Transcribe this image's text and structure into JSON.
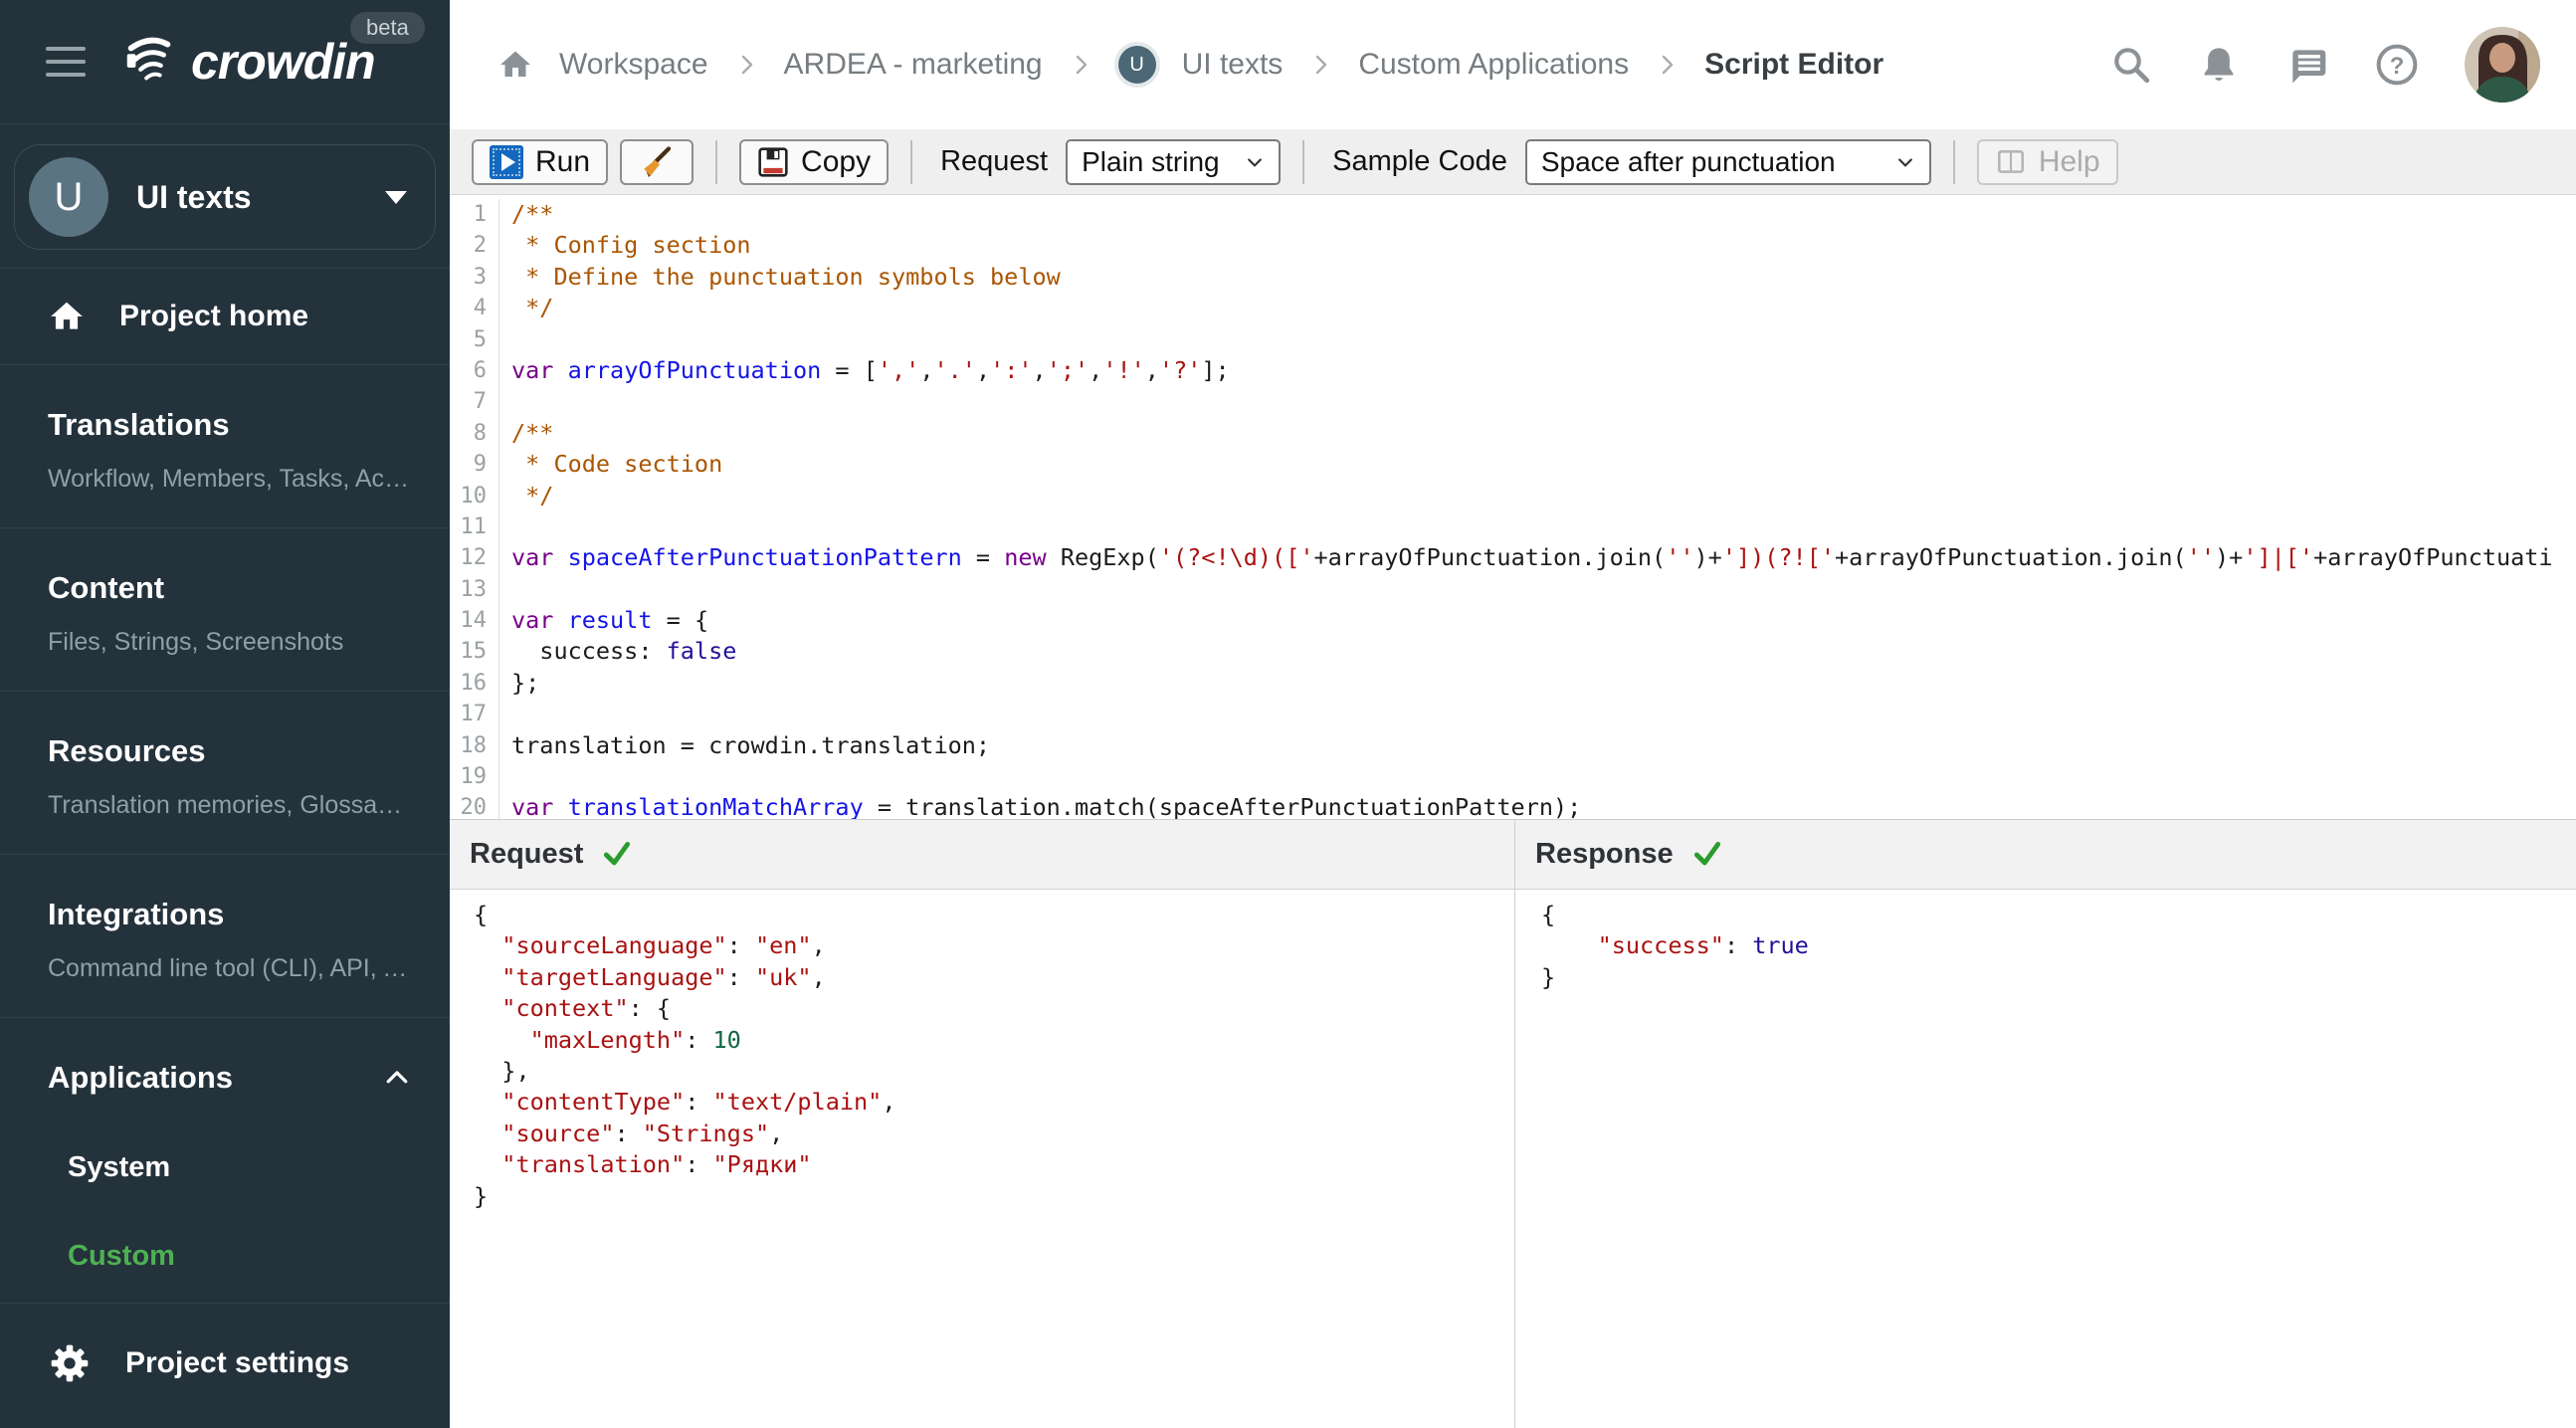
{
  "brand": {
    "logo_text": "crowdin",
    "beta_label": "beta"
  },
  "project_selector": {
    "avatar_letter": "U",
    "name": "UI texts"
  },
  "sidebar": {
    "project_home": "Project home",
    "sections": [
      {
        "title": "Translations",
        "subtitle": "Workflow, Members, Tasks, Act…"
      },
      {
        "title": "Content",
        "subtitle": "Files, Strings, Screenshots"
      },
      {
        "title": "Resources",
        "subtitle": "Translation memories, Glossari…"
      },
      {
        "title": "Integrations",
        "subtitle": "Command line tool (CLI), API, A…"
      }
    ],
    "applications": {
      "title": "Applications",
      "items": [
        {
          "label": "System"
        },
        {
          "label": "Custom"
        }
      ]
    },
    "project_settings": "Project settings"
  },
  "breadcrumb": {
    "badge_letter": "U",
    "items": [
      "Workspace",
      "ARDEA - marketing",
      "UI texts",
      "Custom Applications",
      "Script Editor"
    ]
  },
  "toolbar": {
    "run_label": "Run",
    "copy_label": "Copy",
    "request_label": "Request",
    "request_value": "Plain string",
    "sample_code_label": "Sample Code",
    "sample_code_value": "Space after punctuation",
    "help_label": "Help"
  },
  "panels": {
    "request_title": "Request",
    "response_title": "Response"
  },
  "colors": {
    "sidebar_bg": "#24323C",
    "active_green": "#4FB052",
    "check_green": "#2B9C2B",
    "run_blue": "#1468BE"
  },
  "editor": {
    "lines": [
      [
        [
          "cm",
          "/**"
        ]
      ],
      [
        [
          "cm",
          " * Config section"
        ]
      ],
      [
        [
          "cm",
          " * Define the punctuation symbols below"
        ]
      ],
      [
        [
          "cm",
          " */"
        ]
      ],
      [],
      [
        [
          "kw",
          "var"
        ],
        [
          "pl",
          " "
        ],
        [
          "def",
          "arrayOfPunctuation"
        ],
        [
          "pl",
          " = ["
        ],
        [
          "str",
          "','"
        ],
        [
          "pl",
          ","
        ],
        [
          "str",
          "'.'"
        ],
        [
          "pl",
          ","
        ],
        [
          "str",
          "':'"
        ],
        [
          "pl",
          ","
        ],
        [
          "str",
          "';'"
        ],
        [
          "pl",
          ","
        ],
        [
          "str",
          "'!'"
        ],
        [
          "pl",
          ","
        ],
        [
          "str",
          "'?'"
        ],
        [
          "pl",
          "];"
        ]
      ],
      [],
      [
        [
          "cm",
          "/**"
        ]
      ],
      [
        [
          "cm",
          " * Code section"
        ]
      ],
      [
        [
          "cm",
          " */"
        ]
      ],
      [],
      [
        [
          "kw",
          "var"
        ],
        [
          "pl",
          " "
        ],
        [
          "def",
          "spaceAfterPunctuationPattern"
        ],
        [
          "pl",
          " = "
        ],
        [
          "kw",
          "new"
        ],
        [
          "pl",
          " RegExp("
        ],
        [
          "str",
          "'(?<!\\d)(['"
        ],
        [
          "pl",
          "+arrayOfPunctuation.join("
        ],
        [
          "str",
          "''"
        ],
        [
          "pl",
          ")+"
        ],
        [
          "str",
          "'])(?!['"
        ],
        [
          "pl",
          "+arrayOfPunctuation.join("
        ],
        [
          "str",
          "''"
        ],
        [
          "pl",
          ")+"
        ],
        [
          "str",
          "']|['"
        ],
        [
          "pl",
          "+arrayOfPunctuati"
        ]
      ],
      [],
      [
        [
          "kw",
          "var"
        ],
        [
          "pl",
          " "
        ],
        [
          "def",
          "result"
        ],
        [
          "pl",
          " = {"
        ]
      ],
      [
        [
          "pl",
          "  success: "
        ],
        [
          "atom",
          "false"
        ]
      ],
      [
        [
          "pl",
          "};"
        ]
      ],
      [],
      [
        [
          "pl",
          "translation = crowdin.translation;"
        ]
      ],
      [],
      [
        [
          "kw",
          "var"
        ],
        [
          "pl",
          " "
        ],
        [
          "def",
          "translationMatchArray"
        ],
        [
          "pl",
          " = translation.match(spaceAfterPunctuationPattern);"
        ]
      ],
      []
    ]
  },
  "request_json": {
    "lines": [
      [
        [
          "pl",
          "{"
        ]
      ],
      [
        [
          "pl",
          "  "
        ],
        [
          "str",
          "\"sourceLanguage\""
        ],
        [
          "pl",
          ": "
        ],
        [
          "str",
          "\"en\""
        ],
        [
          "pl",
          ","
        ]
      ],
      [
        [
          "pl",
          "  "
        ],
        [
          "str",
          "\"targetLanguage\""
        ],
        [
          "pl",
          ": "
        ],
        [
          "str",
          "\"uk\""
        ],
        [
          "pl",
          ","
        ]
      ],
      [
        [
          "pl",
          "  "
        ],
        [
          "str",
          "\"context\""
        ],
        [
          "pl",
          ": {"
        ]
      ],
      [
        [
          "pl",
          "    "
        ],
        [
          "str",
          "\"maxLength\""
        ],
        [
          "pl",
          ": "
        ],
        [
          "num",
          "10"
        ]
      ],
      [
        [
          "pl",
          "  },"
        ]
      ],
      [
        [
          "pl",
          "  "
        ],
        [
          "str",
          "\"contentType\""
        ],
        [
          "pl",
          ": "
        ],
        [
          "str",
          "\"text/plain\""
        ],
        [
          "pl",
          ","
        ]
      ],
      [
        [
          "pl",
          "  "
        ],
        [
          "str",
          "\"source\""
        ],
        [
          "pl",
          ": "
        ],
        [
          "str",
          "\"Strings\""
        ],
        [
          "pl",
          ","
        ]
      ],
      [
        [
          "pl",
          "  "
        ],
        [
          "str",
          "\"translation\""
        ],
        [
          "pl",
          ": "
        ],
        [
          "str",
          "\"Рядки\""
        ]
      ],
      [
        [
          "pl",
          "}"
        ]
      ]
    ]
  },
  "response_json": {
    "lines": [
      [
        [
          "pl",
          "{"
        ]
      ],
      [
        [
          "pl",
          "    "
        ],
        [
          "str",
          "\"success\""
        ],
        [
          "pl",
          ": "
        ],
        [
          "atom",
          "true"
        ]
      ],
      [
        [
          "pl",
          "}"
        ]
      ]
    ]
  }
}
